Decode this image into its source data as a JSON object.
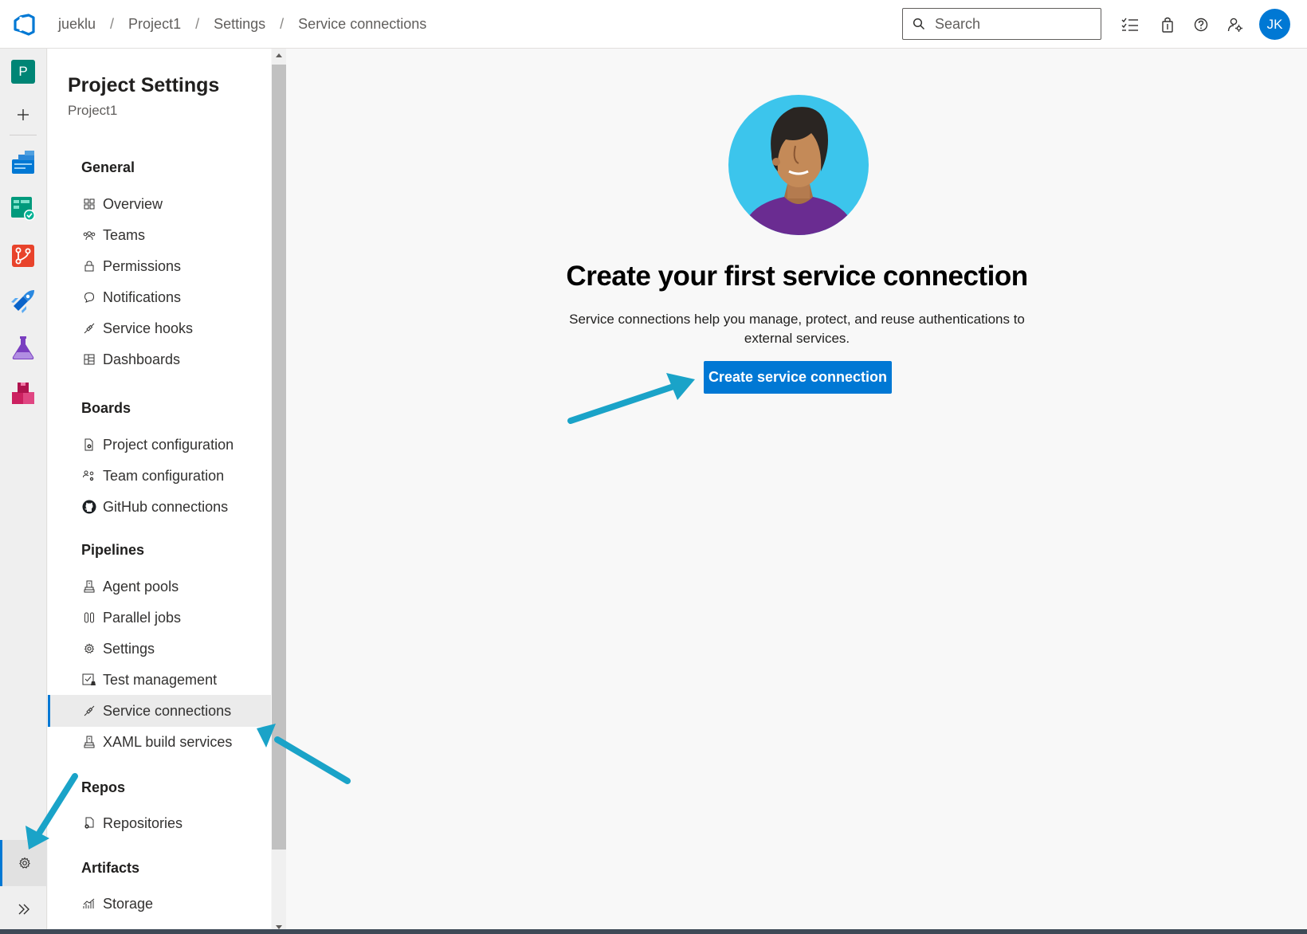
{
  "header": {
    "breadcrumbs": [
      "jueklu",
      "Project1",
      "Settings",
      "Service connections"
    ],
    "search": {
      "placeholder": "Search"
    },
    "avatar_initials": "JK",
    "icons": [
      "azure-devops-logo",
      "task-list-icon",
      "shopping-bag-icon",
      "help-icon",
      "user-settings-icon"
    ]
  },
  "rail": {
    "project_initial": "P",
    "items": [
      "new-project",
      "overview",
      "boards",
      "repos",
      "pipelines",
      "test-plans",
      "artifacts",
      "project-settings",
      "expand"
    ]
  },
  "settings_nav": {
    "title": "Project Settings",
    "subtitle": "Project1",
    "sections": [
      {
        "label": "General",
        "items": [
          {
            "label": "Overview",
            "icon": "overview-icon"
          },
          {
            "label": "Teams",
            "icon": "teams-icon"
          },
          {
            "label": "Permissions",
            "icon": "lock-icon"
          },
          {
            "label": "Notifications",
            "icon": "chat-icon"
          },
          {
            "label": "Service hooks",
            "icon": "plug-icon"
          },
          {
            "label": "Dashboards",
            "icon": "dashboard-icon"
          }
        ]
      },
      {
        "label": "Boards",
        "items": [
          {
            "label": "Project configuration",
            "icon": "doc-gear-icon"
          },
          {
            "label": "Team configuration",
            "icon": "team-gear-icon"
          },
          {
            "label": "GitHub connections",
            "icon": "github-icon"
          }
        ]
      },
      {
        "label": "Pipelines",
        "items": [
          {
            "label": "Agent pools",
            "icon": "agent-icon"
          },
          {
            "label": "Parallel jobs",
            "icon": "parallel-icon"
          },
          {
            "label": "Settings",
            "icon": "gear-icon"
          },
          {
            "label": "Test management",
            "icon": "test-icon"
          },
          {
            "label": "Service connections",
            "icon": "plug-icon",
            "selected": true
          },
          {
            "label": "XAML build services",
            "icon": "agent-icon"
          }
        ]
      },
      {
        "label": "Repos",
        "items": [
          {
            "label": "Repositories",
            "icon": "repo-icon"
          }
        ]
      },
      {
        "label": "Artifacts",
        "items": [
          {
            "label": "Storage",
            "icon": "chart-icon"
          }
        ]
      }
    ]
  },
  "main": {
    "title": "Create your first service connection",
    "description": "Service connections help you manage, protect, and reuse authentications to external services.",
    "button_label": "Create service connection"
  },
  "colors": {
    "accent": "#0078d4",
    "annotation_arrow": "#1aa3c8"
  }
}
